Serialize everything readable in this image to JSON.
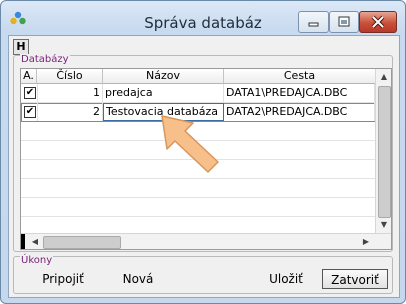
{
  "window": {
    "title": "Správa databáz"
  },
  "toolbar": {
    "h_label": "H"
  },
  "databases": {
    "group_label": "Databázy",
    "columns": [
      "A.",
      "Číslo",
      "Názov",
      "Cesta"
    ],
    "rows": [
      {
        "active": "✔",
        "number": "1",
        "name": "predajca",
        "path": "DATA1\\PREDAJCA.DBC"
      },
      {
        "active": "✔",
        "number": "2",
        "name": "Testovacia databáza",
        "path": "DATA2\\PREDAJCA.DBC"
      }
    ]
  },
  "actions": {
    "group_label": "Úkony",
    "connect": "Pripojiť",
    "new": "Nová",
    "save": "Uložiť",
    "close": "Zatvoriť"
  },
  "colors": {
    "pointer_arrow": "#f7c08a",
    "group_label": "#7a1f7a"
  }
}
